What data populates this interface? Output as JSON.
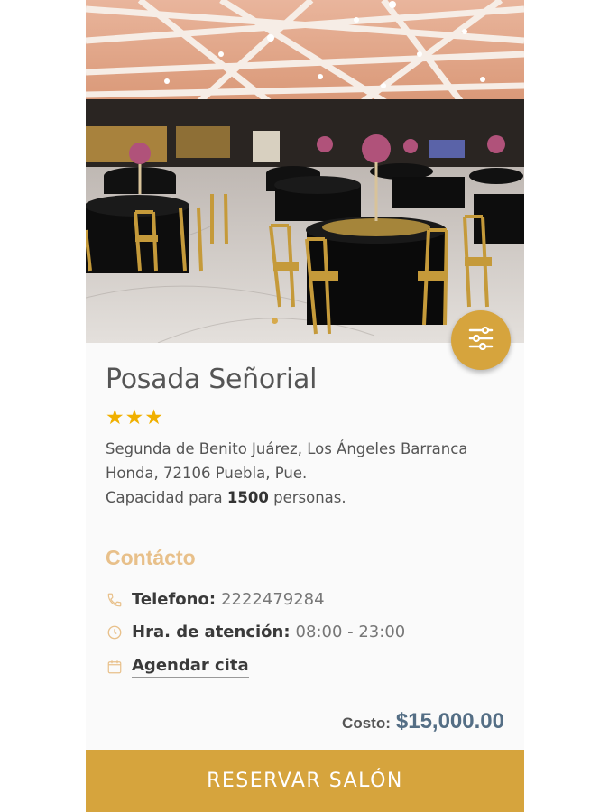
{
  "venue": {
    "name": "Posada Señorial",
    "stars": "★★★",
    "rating": 3,
    "address": "Segunda de Benito Juárez, Los Ángeles Barranca Honda, 72106 Puebla, Pue.",
    "capacity_prefix": "Capacidad para",
    "capacity_value": "1500",
    "capacity_suffix": "personas."
  },
  "gallery": {
    "slide_index": 1
  },
  "contact": {
    "heading": "Contácto",
    "phone_label": "Telefono:",
    "phone_value": "2222479284",
    "hours_label": "Hra. de atención:",
    "hours_value": "08:00 - 23:00",
    "schedule_link": "Agendar cita"
  },
  "cost": {
    "label": "Costo:",
    "value": "$15,000.00"
  },
  "actions": {
    "reserve": "RESERVAR SALÓN",
    "filter_icon": "sliders-icon"
  },
  "colors": {
    "accent": "#d6a43d",
    "section": "#e8c08a",
    "price": "#546e85",
    "stars": "#f0b000"
  }
}
